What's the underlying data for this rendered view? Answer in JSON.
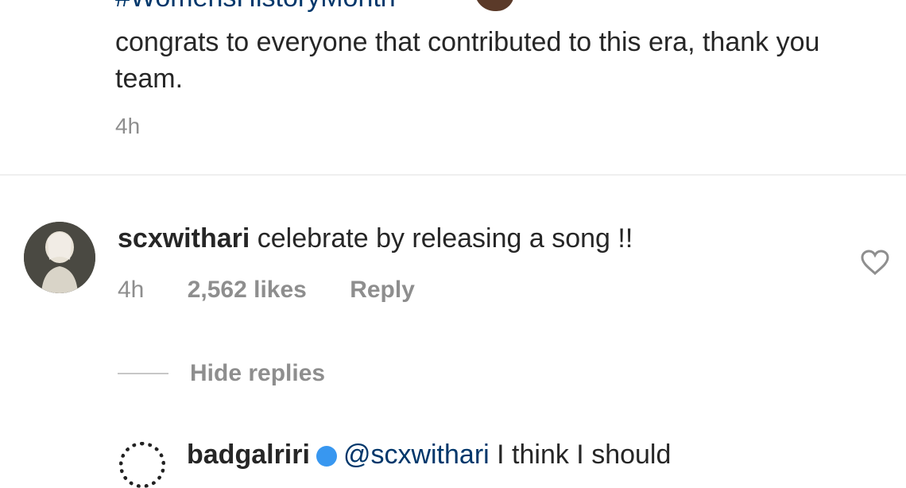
{
  "caption": {
    "hashtag": "#WomensHistoryMonth",
    "text": "congrats to everyone that contributed to this era, thank you team.",
    "time": "4h"
  },
  "comment": {
    "username": "scxwithari",
    "text": " celebrate by releasing a song !!",
    "time": "4h",
    "likes": "2,562 likes",
    "reply_label": "Reply",
    "like_icon": "heart-icon"
  },
  "replies_toggle": {
    "label": "Hide replies"
  },
  "reply": {
    "username": "badgalriri",
    "mention": "@scxwithari",
    "text": " I think I should"
  },
  "colors": {
    "link": "#00376b",
    "muted": "#8e8e8e",
    "text": "#262626",
    "verified": "#3897f0"
  }
}
